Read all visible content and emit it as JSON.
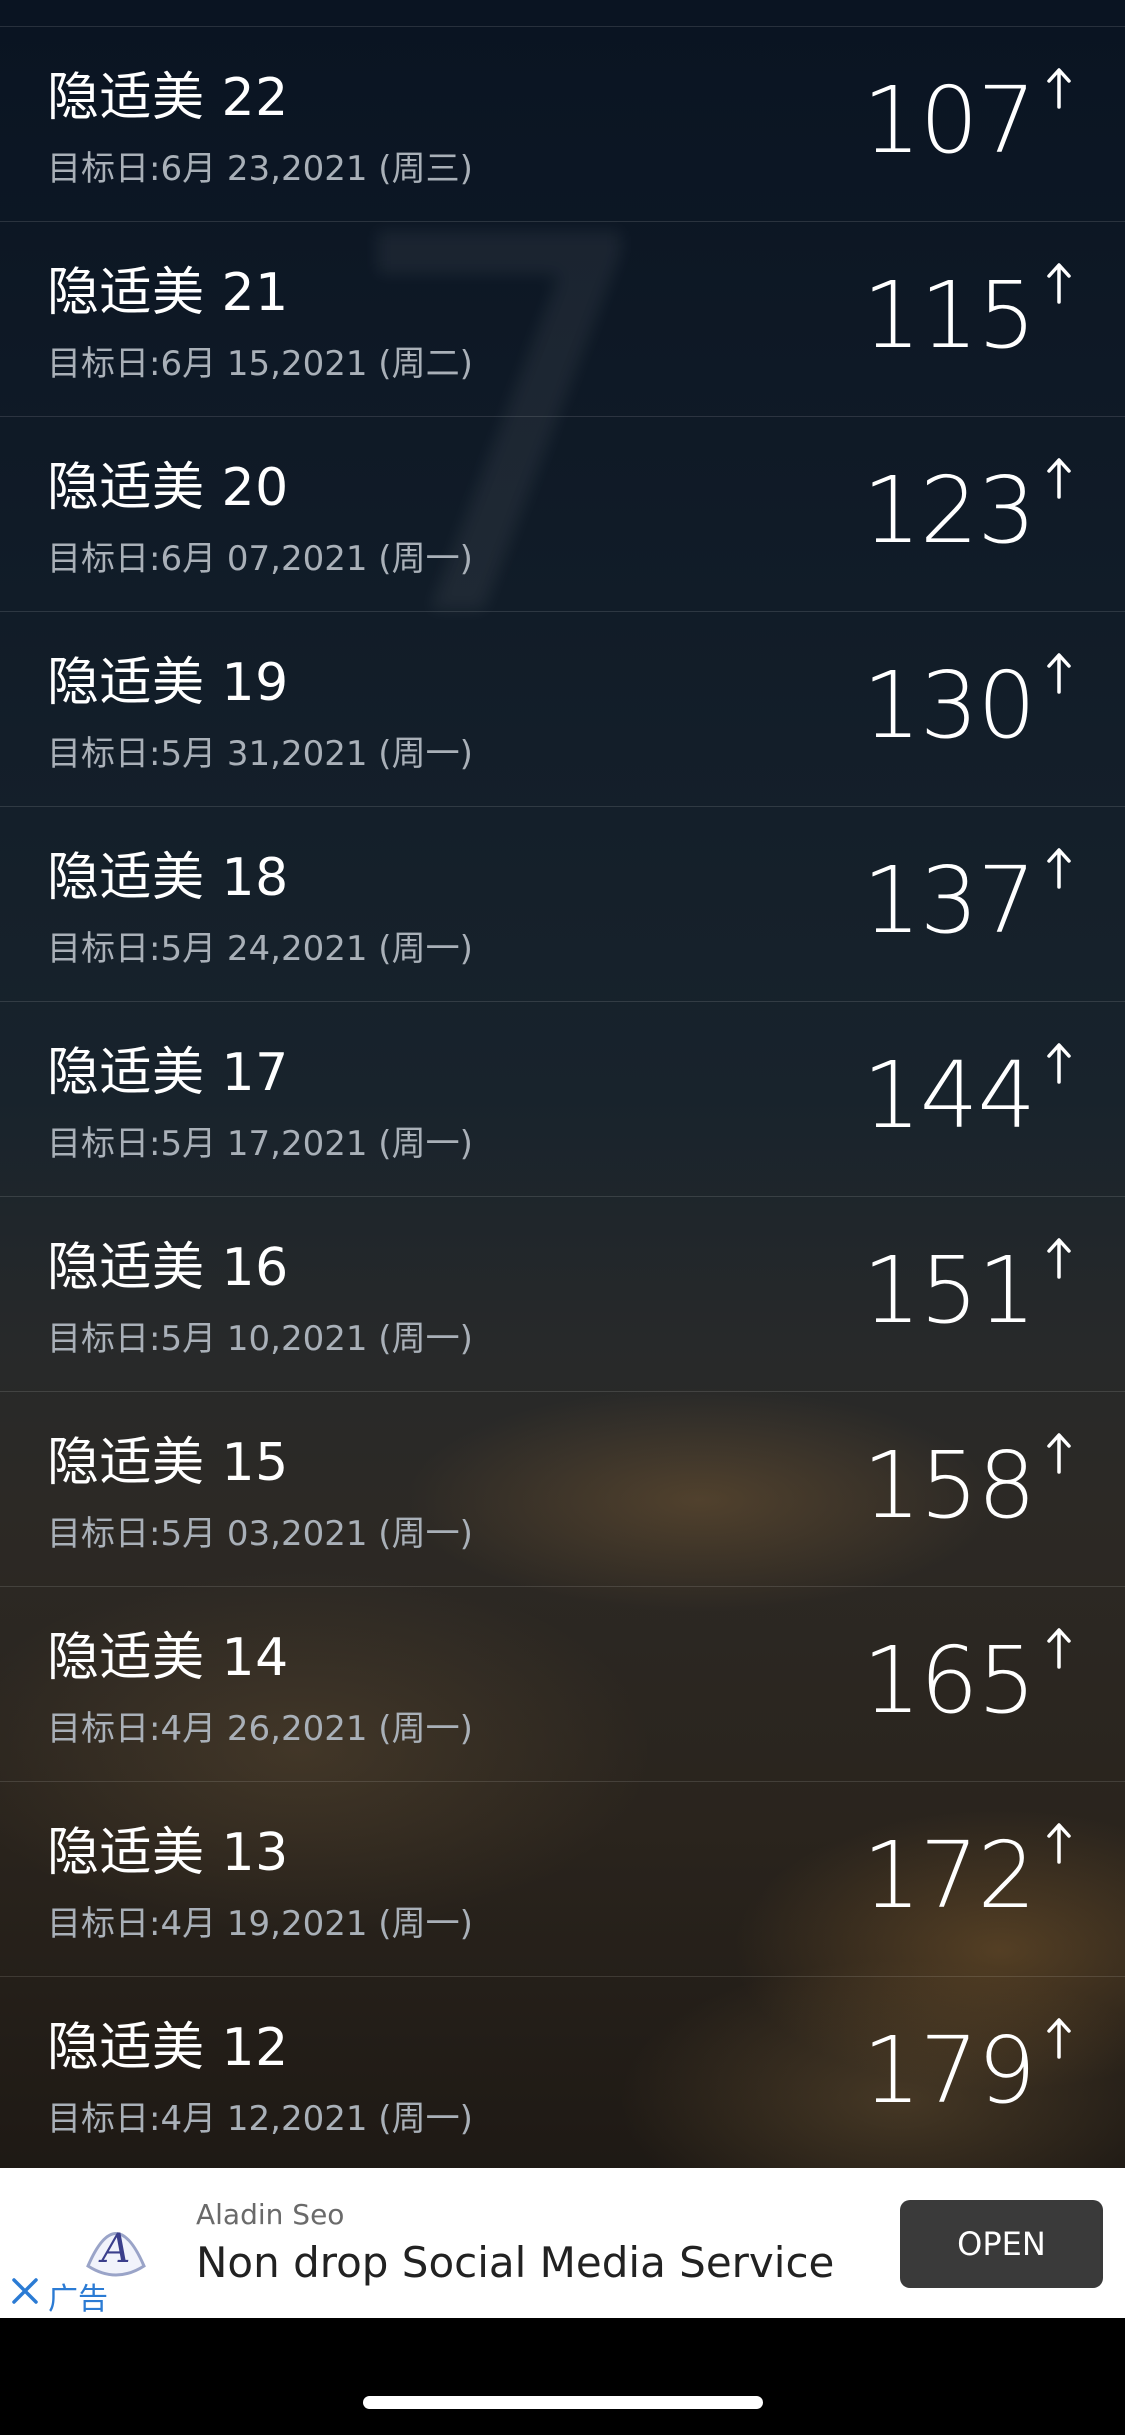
{
  "colors": {
    "text_primary": "#ffffff",
    "text_secondary": "#a9b0b8",
    "ad_button_bg": "#3a3a3a",
    "ad_label": "#2b7bd4"
  },
  "list": {
    "items": [
      {
        "name": "隐适美 22",
        "date": "目标日:6月 23,2021 (周三)",
        "value": "107",
        "trend_icon": "arrow-up-icon"
      },
      {
        "name": "隐适美 21",
        "date": "目标日:6月 15,2021 (周二)",
        "value": "115",
        "trend_icon": "arrow-up-icon"
      },
      {
        "name": "隐适美 20",
        "date": "目标日:6月 07,2021 (周一)",
        "value": "123",
        "trend_icon": "arrow-up-icon"
      },
      {
        "name": "隐适美 19",
        "date": "目标日:5月 31,2021 (周一)",
        "value": "130",
        "trend_icon": "arrow-up-icon"
      },
      {
        "name": "隐适美 18",
        "date": "目标日:5月 24,2021 (周一)",
        "value": "137",
        "trend_icon": "arrow-up-icon"
      },
      {
        "name": "隐适美 17",
        "date": "目标日:5月 17,2021 (周一)",
        "value": "144",
        "trend_icon": "arrow-up-icon"
      },
      {
        "name": "隐适美 16",
        "date": "目标日:5月 10,2021 (周一)",
        "value": "151",
        "trend_icon": "arrow-up-icon"
      },
      {
        "name": "隐适美 15",
        "date": "目标日:5月 03,2021 (周一)",
        "value": "158",
        "trend_icon": "arrow-up-icon"
      },
      {
        "name": "隐适美 14",
        "date": "目标日:4月 26,2021 (周一)",
        "value": "165",
        "trend_icon": "arrow-up-icon"
      },
      {
        "name": "隐适美 13",
        "date": "目标日:4月 19,2021 (周一)",
        "value": "172",
        "trend_icon": "arrow-up-icon"
      },
      {
        "name": "隐适美 12",
        "date": "目标日:4月 12,2021 (周一)",
        "value": "179",
        "trend_icon": "arrow-up-icon"
      }
    ]
  },
  "ad": {
    "source": "Aladin Seo",
    "title": "Non drop Social Media Service",
    "button_label": "OPEN",
    "ad_label": "广告",
    "logo_icon": "aladin-logo-icon",
    "close_icon": "close-icon"
  }
}
